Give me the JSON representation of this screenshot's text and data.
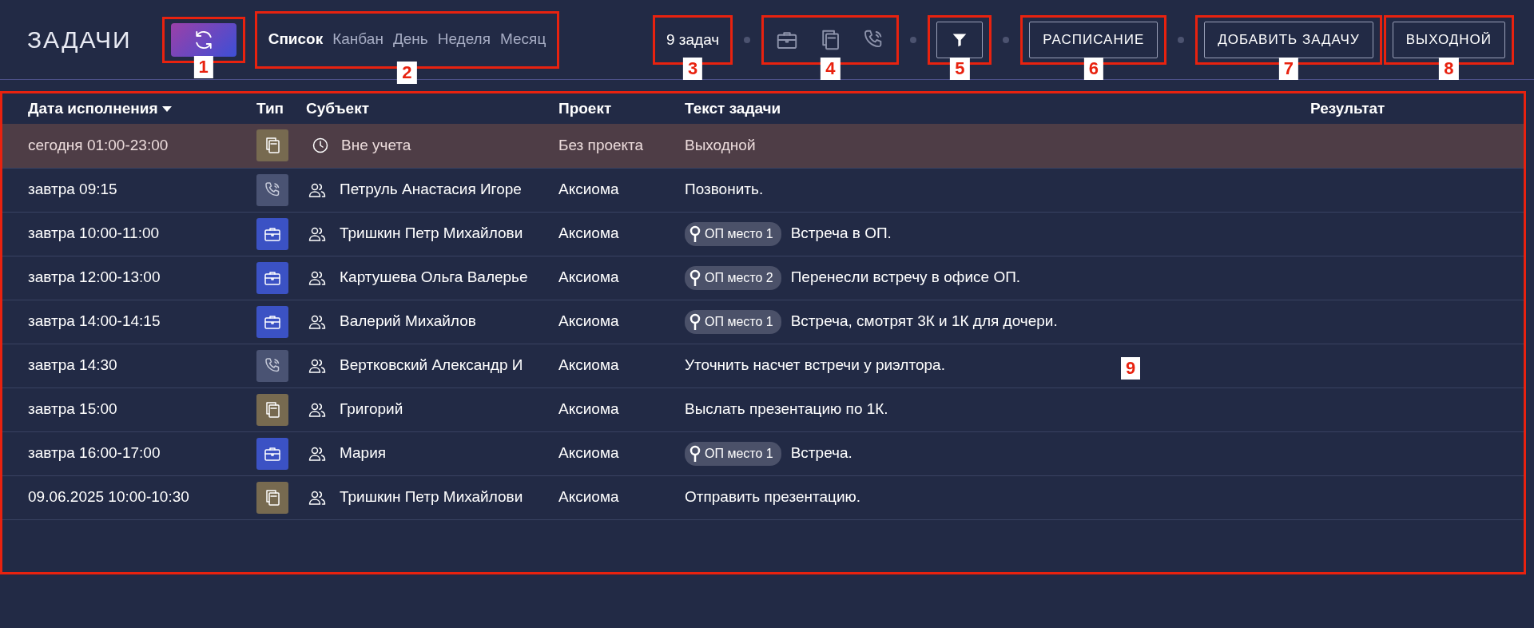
{
  "header": {
    "title": "ЗАДАЧИ",
    "refresh_button": {
      "callout": "1"
    },
    "view_tabs": {
      "callout": "2",
      "tabs": [
        {
          "label": "Список",
          "selected": true
        },
        {
          "label": "Канбан",
          "selected": false
        },
        {
          "label": "День",
          "selected": false
        },
        {
          "label": "Неделя",
          "selected": false
        },
        {
          "label": "Месяц",
          "selected": false
        }
      ]
    },
    "task_count": {
      "text": "9 задач",
      "callout": "3"
    },
    "type_filters": {
      "callout": "4",
      "items": [
        {
          "kind": "meeting"
        },
        {
          "kind": "document"
        },
        {
          "kind": "call"
        }
      ]
    },
    "filter_button": {
      "callout": "5"
    },
    "schedule_button": {
      "label": "РАСПИСАНИЕ",
      "callout": "6"
    },
    "add_button": {
      "label": "ДОБАВИТЬ ЗАДАЧУ",
      "callout": "7"
    },
    "day_off_button": {
      "label": "ВЫХОДНОЙ",
      "callout": "8"
    }
  },
  "table": {
    "callout": "9",
    "columns": [
      "Дата исполнения",
      "Тип",
      "Субъект",
      "Проект",
      "Текст задачи",
      "Результат"
    ],
    "rows": [
      {
        "date": "сегодня 01:00-23:00",
        "type_icon": {
          "kind": "document"
        },
        "subject_icon": {
          "kind": "clock"
        },
        "subject": "Вне учета",
        "project": "Без проекта",
        "tag": "",
        "text": "Выходной",
        "highlighted": true
      },
      {
        "date": "завтра 09:15",
        "type_icon": {
          "kind": "call"
        },
        "subject_icon": {
          "kind": "people"
        },
        "subject": "Петруль Анастасия Игоре",
        "project": "Аксиома",
        "tag": "",
        "text": "Позвонить.",
        "highlighted": false
      },
      {
        "date": "завтра 10:00-11:00",
        "type_icon": {
          "kind": "meeting"
        },
        "subject_icon": {
          "kind": "people"
        },
        "subject": "Тришкин Петр Михайлови",
        "project": "Аксиома",
        "tag": "ОП место 1",
        "text": "Встреча в ОП.",
        "highlighted": false
      },
      {
        "date": "завтра 12:00-13:00",
        "type_icon": {
          "kind": "meeting"
        },
        "subject_icon": {
          "kind": "people"
        },
        "subject": "Картушева Ольга Валерье",
        "project": "Аксиома",
        "tag": "ОП место 2",
        "text": "Перенесли встречу в офисе ОП.",
        "highlighted": false
      },
      {
        "date": "завтра 14:00-14:15",
        "type_icon": {
          "kind": "meeting"
        },
        "subject_icon": {
          "kind": "people"
        },
        "subject": "Валерий Михайлов",
        "project": "Аксиома",
        "tag": "ОП место 1",
        "text": "Встреча, смотрят 3К и 1К для дочери.",
        "highlighted": false
      },
      {
        "date": "завтра 14:30",
        "type_icon": {
          "kind": "call"
        },
        "subject_icon": {
          "kind": "people"
        },
        "subject": "Вертковский Александр И",
        "project": "Аксиома",
        "tag": "",
        "text": "Уточнить насчет встречи у риэлтора.",
        "highlighted": false
      },
      {
        "date": "завтра 15:00",
        "type_icon": {
          "kind": "document"
        },
        "subject_icon": {
          "kind": "people"
        },
        "subject": "Григорий",
        "project": "Аксиома",
        "tag": "",
        "text": "Выслать презентацию по 1К.",
        "highlighted": false
      },
      {
        "date": "завтра 16:00-17:00",
        "type_icon": {
          "kind": "meeting"
        },
        "subject_icon": {
          "kind": "people"
        },
        "subject": "Мария",
        "project": "Аксиома",
        "tag": "ОП место 1",
        "text": "Встреча.",
        "highlighted": false
      },
      {
        "date": "09.06.2025 10:00-10:30",
        "type_icon": {
          "kind": "document"
        },
        "subject_icon": {
          "kind": "people"
        },
        "subject": "Тришкин Петр Михайлови",
        "project": "Аксиома",
        "tag": "",
        "text": "Отправить презентацию.",
        "highlighted": false
      }
    ]
  }
}
